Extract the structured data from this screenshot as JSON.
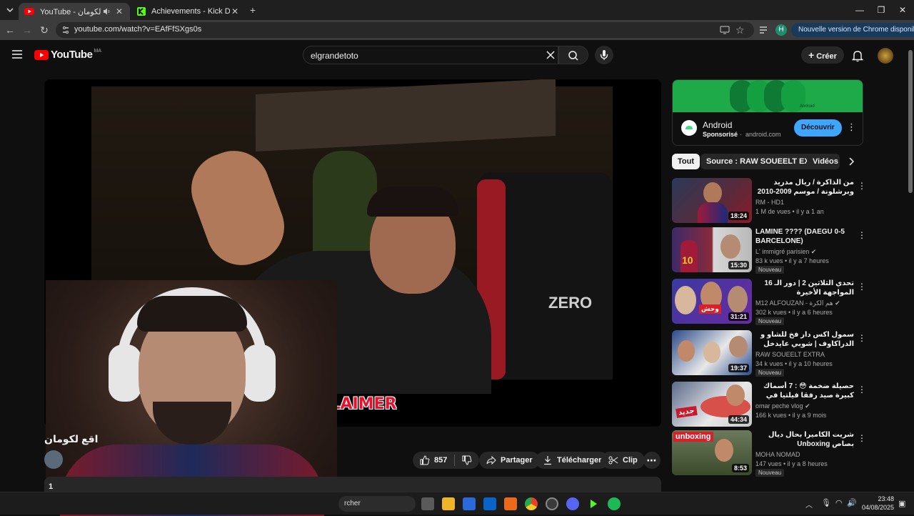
{
  "browser": {
    "tabs": [
      {
        "title": "YouTube - شنو واقع لكومان",
        "active": true
      },
      {
        "title": "Achievements - Kick Dashboard",
        "active": false
      }
    ],
    "url": "youtube.com/watch?v=EAfFfSXgs0s",
    "profile_initial": "H",
    "update_label": "Nouvelle version de Chrome disponible"
  },
  "youtube": {
    "logo_text": "YouTube",
    "region": "MA",
    "search_value": "elgrandetoto",
    "create_label": "Créer"
  },
  "video": {
    "overlay_text": "DISCLAIMER",
    "title": "اقع لكومان",
    "likes": "857",
    "share_label": "Partager",
    "download_label": "Télécharger",
    "clip_label": "Clip",
    "desc_prefix": "1"
  },
  "ad": {
    "brand": "Android",
    "sponsored": "Sponsorisé",
    "domain": "android.com",
    "cta": "Découvrir",
    "banner_text": "Android"
  },
  "chips": [
    "Tout",
    "Source : RAW SOUEELT EXTRA",
    "Vidéos s"
  ],
  "recommendations": [
    {
      "title": "من الذاكرة / ريال مدريد وبرشلونة / موسم 2009-2010 تحقيق عصام الشوالي جودة ...",
      "channel": "RM - HD1",
      "meta": "1 M de vues • il y a 1 an",
      "duration": "18:24",
      "badge": ""
    },
    {
      "title": "LAMINE ???? (DAEGU 0-5 BARCELONE)",
      "channel": "L' immigré parisien",
      "meta": "83 k vues • il y a 7 heures",
      "duration": "15:30",
      "badge": "Nouveau"
    },
    {
      "title": "تحدي الثلاثين 2 | دور الـ 16 المواجهة الأخيرة",
      "channel": "M12 ALFOUZAN - هم الكرة",
      "meta": "302 k vues • il y a 6 heures",
      "duration": "31:21",
      "badge": "Nouveau"
    },
    {
      "title": "سمول اكس دار فخ للشاو و الدراكاوف | شوبي عايدخل في الليف",
      "channel": "RAW SOUEELT EXTRA",
      "meta": "34 k vues • il y a 10 heures",
      "duration": "19:37",
      "badge": "Nouveau"
    },
    {
      "title": "حصيلة ضخمة 😳 : 7 أسماك كبيرة صيد رفقا فيلتيا في فصل الشتاء🌧",
      "channel": "omar peche vlog",
      "meta": "166 k vues • il y a 9 mois",
      "duration": "44:34",
      "badge": ""
    },
    {
      "title": "شريت الكاميرا بحال ديال بصاص Unboxing",
      "channel": "MOHA NOMAD",
      "meta": "147 vues • il y a 8 heures",
      "duration": "8:53",
      "badge": "Nouveau"
    }
  ],
  "taskbar": {
    "search_label": "rcher",
    "time": "23:48",
    "date": "04/08/2025"
  }
}
